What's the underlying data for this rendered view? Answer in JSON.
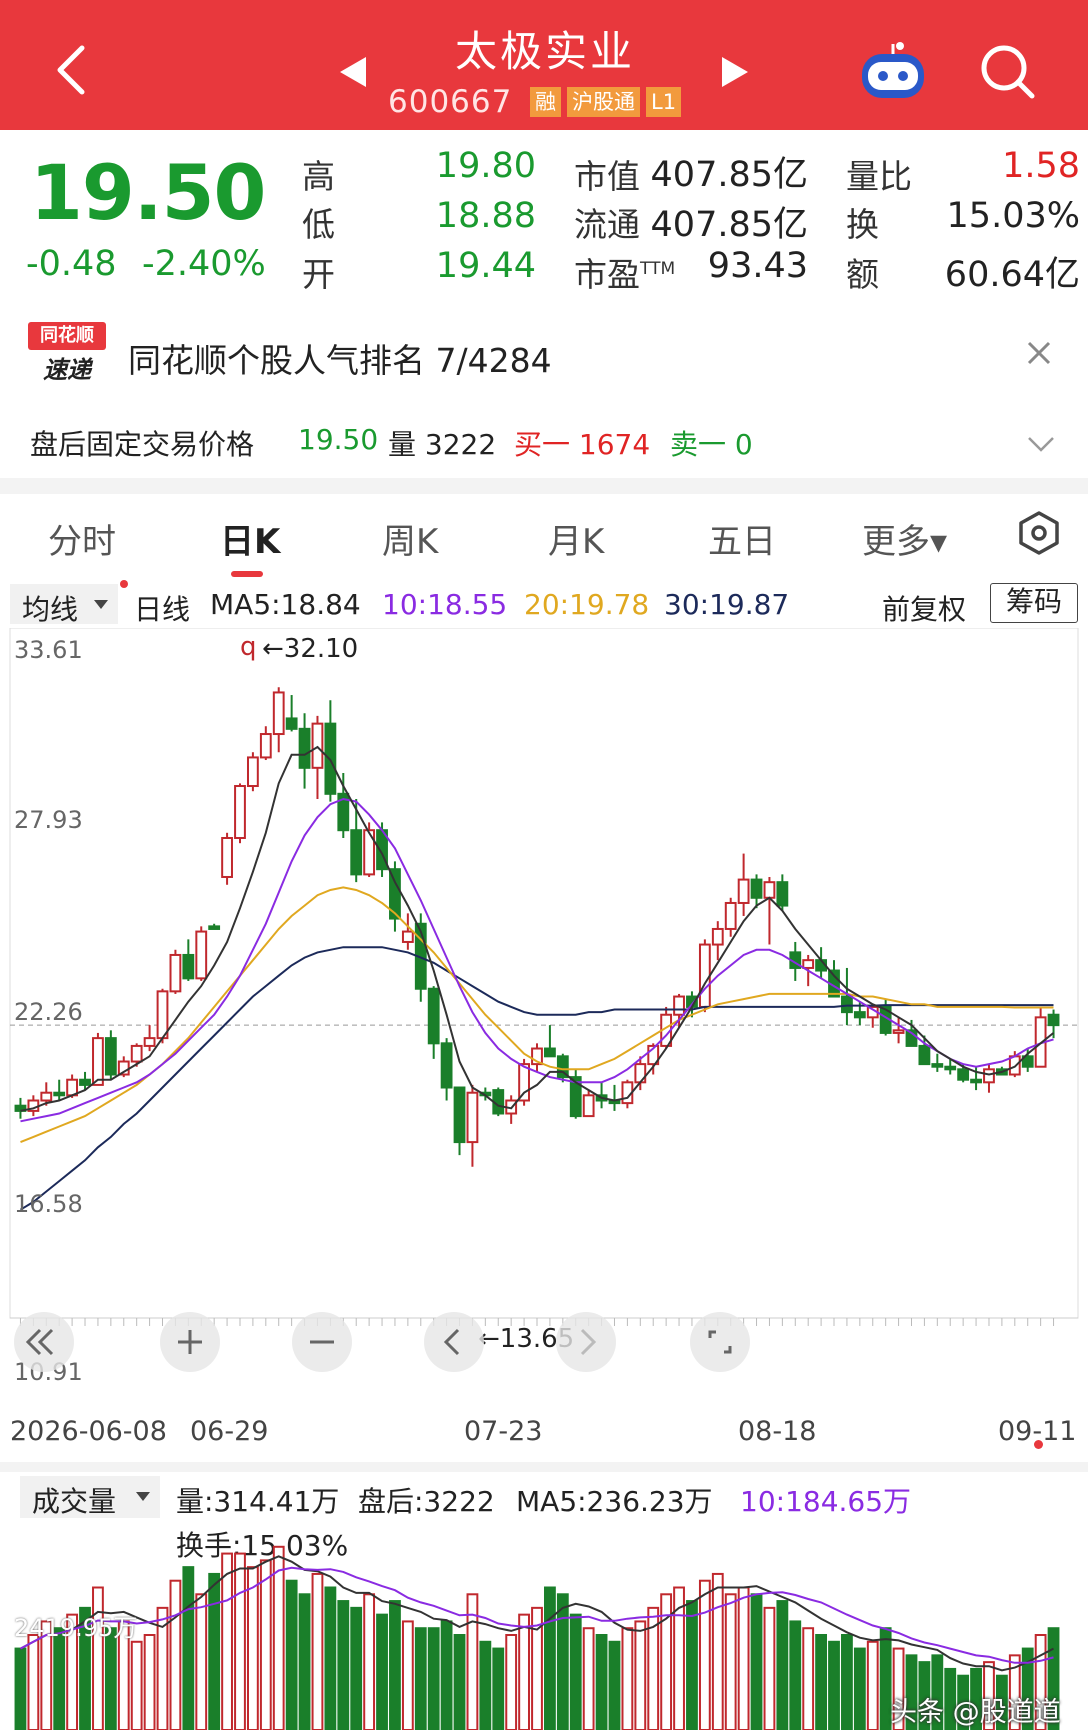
{
  "header": {
    "stock_name": "太极实业",
    "stock_code": "600667",
    "tags": [
      "融",
      "沪股通",
      "L1"
    ],
    "bg_color": "#e8383d"
  },
  "quote": {
    "price": "19.50",
    "change": "-0.48",
    "change_pct": "-2.40%",
    "high_label": "高",
    "high": "19.80",
    "low_label": "低",
    "low": "18.88",
    "open_label": "开",
    "open": "19.44",
    "mcap_label": "市值",
    "mcap": "407.85亿",
    "float_label": "流通",
    "float": "407.85亿",
    "pe_label": "市盈",
    "pe_sup": "TTM",
    "pe": "93.43",
    "vr_label": "量比",
    "vr": "1.58",
    "turnover_label": "换",
    "turnover": "15.03%",
    "amount_label": "额",
    "amount": "60.64亿"
  },
  "news": {
    "logo_line1": "同花顺",
    "logo_line2": "速递",
    "text": "同花顺个股人气排名 7/4284"
  },
  "after_hours": {
    "label": "盘后固定交易价格",
    "price": "19.50",
    "vol_label": "量 3222",
    "buy_label": "买一 1674",
    "sell_label": "卖一 0"
  },
  "tabs": [
    {
      "label": "分时"
    },
    {
      "label": "日K"
    },
    {
      "label": "周K"
    },
    {
      "label": "月K"
    },
    {
      "label": "五日"
    },
    {
      "label": "更多▾"
    }
  ],
  "ma_row": {
    "type_dd": "均线",
    "line": "日线",
    "ma5": "MA5:18.84",
    "ma10": "10:18.55",
    "ma20": "20:19.78",
    "ma30": "30:19.87",
    "adjust": "前复权",
    "chip_btn": "筹码"
  },
  "chart_axes": {
    "y_ticks": [
      "33.61",
      "27.93",
      "22.26",
      "16.58",
      "10.91"
    ],
    "x_ticks": [
      "2026-06-08",
      "06-29",
      "07-23",
      "08-18",
      "09-11"
    ],
    "max_label": "←32.10",
    "min_label": "←13.65",
    "q_label": "q"
  },
  "chart_data": {
    "type": "candlestick",
    "ylim": [
      10.91,
      33.61
    ],
    "colors": {
      "up": "#c0282d",
      "down": "#1a7f2a",
      "ma5": "#333333",
      "ma10": "#8a2be2",
      "ma20": "#e0a820",
      "ma30": "#1c2a5a"
    },
    "ohlc": [
      [
        16.0,
        16.3,
        15.5,
        15.8
      ],
      [
        15.8,
        16.4,
        15.6,
        16.2
      ],
      [
        16.2,
        16.9,
        16.0,
        16.5
      ],
      [
        16.5,
        17.0,
        16.2,
        16.4
      ],
      [
        16.4,
        17.2,
        16.3,
        17.0
      ],
      [
        17.0,
        17.3,
        16.6,
        16.8
      ],
      [
        16.8,
        18.8,
        16.8,
        18.6
      ],
      [
        18.6,
        18.9,
        17.0,
        17.2
      ],
      [
        17.2,
        17.9,
        17.1,
        17.7
      ],
      [
        17.7,
        18.4,
        17.5,
        18.3
      ],
      [
        18.3,
        19.1,
        18.1,
        18.6
      ],
      [
        18.6,
        20.5,
        18.4,
        20.4
      ],
      [
        20.4,
        22.0,
        20.3,
        21.8
      ],
      [
        21.8,
        22.4,
        20.8,
        20.9
      ],
      [
        20.9,
        22.9,
        20.8,
        22.7
      ],
      [
        22.9,
        23.0,
        22.8,
        22.8
      ],
      [
        24.8,
        26.5,
        24.5,
        26.3
      ],
      [
        26.3,
        28.4,
        26.1,
        28.3
      ],
      [
        28.3,
        29.6,
        28.1,
        29.4
      ],
      [
        29.4,
        30.6,
        29.3,
        30.3
      ],
      [
        30.3,
        32.1,
        29.6,
        31.9
      ],
      [
        30.9,
        31.8,
        30.4,
        30.5
      ],
      [
        30.5,
        31.1,
        28.2,
        29.0
      ],
      [
        29.0,
        31.0,
        27.8,
        30.7
      ],
      [
        30.7,
        31.6,
        27.7,
        28.0
      ],
      [
        28.0,
        28.8,
        26.3,
        26.6
      ],
      [
        26.6,
        27.8,
        24.6,
        24.9
      ],
      [
        24.9,
        26.9,
        24.8,
        26.6
      ],
      [
        26.6,
        26.9,
        24.8,
        25.1
      ],
      [
        25.1,
        25.4,
        22.7,
        23.2
      ],
      [
        22.3,
        23.4,
        22.0,
        22.7
      ],
      [
        23.0,
        23.4,
        20.0,
        20.5
      ],
      [
        20.5,
        20.6,
        17.8,
        18.4
      ],
      [
        18.4,
        18.6,
        16.2,
        16.7
      ],
      [
        16.7,
        16.7,
        14.1,
        14.6
      ],
      [
        14.6,
        16.8,
        13.65,
        16.5
      ],
      [
        16.5,
        16.7,
        16.2,
        16.4
      ],
      [
        16.6,
        16.7,
        15.6,
        15.7
      ],
      [
        15.7,
        16.4,
        15.3,
        16.2
      ],
      [
        16.2,
        17.8,
        16.0,
        17.6
      ],
      [
        17.6,
        18.4,
        17.3,
        18.2
      ],
      [
        18.2,
        19.1,
        17.9,
        17.9
      ],
      [
        17.9,
        18.0,
        16.9,
        17.1
      ],
      [
        17.1,
        17.4,
        15.5,
        15.6
      ],
      [
        15.6,
        16.6,
        15.7,
        16.4
      ],
      [
        16.4,
        16.9,
        15.9,
        16.2
      ],
      [
        16.2,
        16.8,
        15.8,
        16.1
      ],
      [
        16.1,
        17.0,
        15.9,
        16.9
      ],
      [
        16.9,
        17.9,
        16.6,
        17.6
      ],
      [
        17.6,
        18.4,
        17.2,
        18.3
      ],
      [
        18.3,
        19.8,
        18.2,
        19.5
      ],
      [
        19.5,
        20.3,
        19.0,
        20.2
      ],
      [
        20.2,
        20.4,
        19.4,
        19.8
      ],
      [
        19.8,
        22.4,
        19.6,
        22.2
      ],
      [
        22.2,
        23.1,
        21.6,
        22.8
      ],
      [
        22.8,
        24.0,
        22.5,
        23.8
      ],
      [
        23.8,
        25.7,
        23.3,
        24.7
      ],
      [
        24.7,
        24.9,
        23.6,
        24.0
      ],
      [
        24.0,
        24.8,
        22.2,
        24.6
      ],
      [
        24.6,
        24.9,
        23.5,
        23.7
      ],
      [
        21.9,
        22.3,
        20.8,
        21.3
      ],
      [
        21.3,
        21.8,
        20.6,
        21.6
      ],
      [
        21.6,
        22.1,
        20.9,
        21.2
      ],
      [
        21.2,
        21.6,
        20.4,
        20.2
      ],
      [
        20.2,
        21.3,
        19.1,
        19.6
      ],
      [
        19.6,
        20.0,
        19.1,
        19.4
      ],
      [
        19.4,
        19.9,
        19.0,
        19.8
      ],
      [
        19.8,
        20.1,
        18.7,
        18.8
      ],
      [
        18.8,
        19.4,
        18.4,
        18.9
      ],
      [
        18.9,
        19.3,
        18.3,
        18.3
      ],
      [
        18.3,
        18.7,
        17.8,
        17.6
      ],
      [
        17.6,
        18.0,
        17.3,
        17.5
      ],
      [
        17.5,
        17.8,
        17.2,
        17.4
      ],
      [
        17.4,
        17.6,
        16.9,
        17.0
      ],
      [
        17.0,
        17.5,
        16.6,
        16.9
      ],
      [
        16.9,
        17.6,
        16.5,
        17.4
      ],
      [
        17.4,
        17.5,
        17.2,
        17.2
      ],
      [
        17.2,
        18.1,
        17.1,
        17.9
      ],
      [
        17.9,
        18.2,
        17.3,
        17.5
      ],
      [
        17.5,
        19.8,
        17.5,
        19.4
      ],
      [
        19.5,
        19.7,
        18.6,
        19.1
      ]
    ],
    "ma5": [
      15.8,
      15.9,
      16.1,
      16.2,
      16.4,
      16.6,
      17.0,
      17.0,
      17.3,
      17.6,
      17.9,
      18.6,
      19.3,
      20.0,
      20.6,
      21.4,
      22.3,
      23.6,
      25.0,
      26.5,
      28.4,
      29.5,
      29.5,
      29.8,
      29.3,
      28.3,
      27.4,
      26.5,
      25.7,
      24.6,
      23.7,
      22.7,
      21.2,
      19.5,
      17.7,
      16.7,
      16.4,
      16.0,
      15.9,
      16.5,
      16.8,
      17.3,
      17.3,
      16.9,
      16.6,
      16.3,
      16.2,
      16.3,
      16.9,
      17.5,
      18.2,
      19.0,
      19.8,
      20.7,
      21.5,
      22.3,
      23.1,
      23.7,
      24.0,
      23.5,
      22.8,
      22.2,
      21.6,
      21.0,
      20.5,
      20.2,
      19.9,
      19.7,
      19.4,
      19.1,
      18.6,
      18.1,
      17.8,
      17.5,
      17.3,
      17.2,
      17.3,
      17.5,
      18.0,
      18.4,
      18.8
    ],
    "ma10": [
      15.4,
      15.5,
      15.6,
      15.7,
      15.9,
      16.1,
      16.3,
      16.5,
      16.7,
      16.9,
      17.2,
      17.6,
      18.0,
      18.5,
      19.0,
      19.5,
      20.2,
      21.0,
      22.0,
      23.0,
      24.2,
      25.4,
      26.4,
      27.1,
      27.6,
      27.8,
      27.7,
      27.2,
      26.6,
      25.9,
      24.9,
      23.9,
      22.8,
      21.7,
      20.6,
      19.6,
      18.8,
      18.2,
      17.8,
      17.5,
      17.3,
      17.1,
      17.0,
      16.9,
      16.9,
      16.9,
      17.1,
      17.4,
      17.8,
      18.2,
      18.7,
      19.3,
      19.9,
      20.5,
      21.0,
      21.4,
      21.8,
      22.0,
      22.0,
      21.8,
      21.5,
      21.2,
      20.9,
      20.6,
      20.3,
      20.0,
      19.7,
      19.4,
      19.1,
      18.8,
      18.4,
      18.1,
      17.8,
      17.6,
      17.5,
      17.6,
      17.7,
      17.9,
      18.2,
      18.4,
      18.55
    ],
    "ma20": [
      14.6,
      14.8,
      15.0,
      15.2,
      15.4,
      15.6,
      15.9,
      16.2,
      16.5,
      16.8,
      17.2,
      17.6,
      18.1,
      18.6,
      19.2,
      19.8,
      20.4,
      21.0,
      21.6,
      22.2,
      22.8,
      23.3,
      23.7,
      24.1,
      24.3,
      24.4,
      24.3,
      24.1,
      23.8,
      23.4,
      22.9,
      22.4,
      21.9,
      21.3,
      20.7,
      20.1,
      19.5,
      19.0,
      18.5,
      18.0,
      17.7,
      17.5,
      17.4,
      17.4,
      17.4,
      17.6,
      17.8,
      18.1,
      18.4,
      18.7,
      19.0,
      19.3,
      19.5,
      19.7,
      19.9,
      20.0,
      20.1,
      20.2,
      20.3,
      20.3,
      20.3,
      20.3,
      20.3,
      20.3,
      20.3,
      20.2,
      20.2,
      20.1,
      20.0,
      19.9,
      19.9,
      19.8,
      19.8,
      19.8,
      19.8,
      19.8,
      19.8,
      19.78,
      19.78,
      19.78,
      19.78
    ],
    "ma30": [
      12.0,
      12.3,
      12.7,
      13.1,
      13.5,
      13.9,
      14.4,
      14.8,
      15.3,
      15.7,
      16.2,
      16.7,
      17.2,
      17.7,
      18.2,
      18.7,
      19.2,
      19.7,
      20.2,
      20.6,
      21.0,
      21.4,
      21.7,
      21.9,
      22.0,
      22.1,
      22.1,
      22.1,
      22.1,
      22.0,
      21.9,
      21.7,
      21.5,
      21.2,
      20.9,
      20.6,
      20.3,
      20.0,
      19.8,
      19.6,
      19.5,
      19.5,
      19.5,
      19.5,
      19.6,
      19.6,
      19.7,
      19.7,
      19.7,
      19.7,
      19.7,
      19.7,
      19.7,
      19.8,
      19.8,
      19.8,
      19.8,
      19.8,
      19.8,
      19.8,
      19.8,
      19.8,
      19.8,
      19.8,
      19.85,
      19.85,
      19.85,
      19.87,
      19.87,
      19.87,
      19.87,
      19.87,
      19.87,
      19.87,
      19.87,
      19.87,
      19.87,
      19.87,
      19.87,
      19.87,
      19.87
    ],
    "volume": [
      120,
      140,
      160,
      150,
      170,
      180,
      210,
      150,
      160,
      130,
      140,
      180,
      220,
      240,
      200,
      230,
      260,
      260,
      240,
      250,
      270,
      220,
      200,
      230,
      210,
      190,
      180,
      200,
      170,
      190,
      160,
      150,
      150,
      160,
      140,
      200,
      130,
      120,
      140,
      170,
      180,
      210,
      200,
      170,
      150,
      140,
      130,
      150,
      160,
      180,
      200,
      210,
      190,
      220,
      230,
      200,
      210,
      200,
      180,
      190,
      160,
      150,
      140,
      130,
      140,
      120,
      130,
      150,
      120,
      110,
      100,
      110,
      90,
      80,
      90,
      100,
      80,
      110,
      120,
      140,
      150
    ]
  },
  "volume_header": {
    "type_dd": "成交量",
    "vol": "量:314.41万",
    "after": "盘后:3222",
    "ma5": "MA5:236.23万",
    "ma10": "10:184.65万",
    "turnover": "换手:15.03%",
    "axis_label": "2419.95万"
  },
  "watermark": "头条 @股道道"
}
